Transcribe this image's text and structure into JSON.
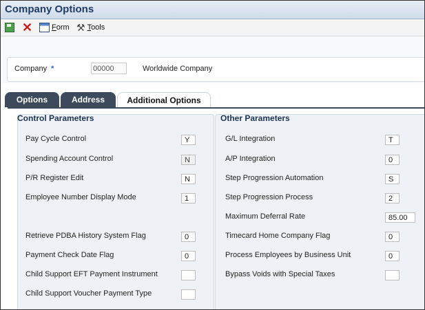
{
  "window": {
    "title": "Company Options"
  },
  "toolbar": {
    "save_icon": "save-icon",
    "cancel_icon": "cancel-icon",
    "form_label_u": "F",
    "form_label_rest": "orm",
    "tools_label_u": "T",
    "tools_label_rest": "ools"
  },
  "company": {
    "label": "Company",
    "required_mark": "*",
    "value": "00000",
    "name": "Worldwide Company"
  },
  "tabs": [
    {
      "label": "Options",
      "active": false
    },
    {
      "label": "Address",
      "active": false
    },
    {
      "label": "Additional Options",
      "active": true
    }
  ],
  "control_parameters": {
    "title": "Control Parameters",
    "fields": [
      {
        "label": "Pay Cycle Control",
        "value": "Y",
        "readonly": false
      },
      {
        "label": "Spending Account Control",
        "value": "N",
        "readonly": true
      },
      {
        "label": "P/R Register Edit",
        "value": "N",
        "readonly": false
      },
      {
        "label": "Employee Number Display Mode",
        "value": "1",
        "readonly": false
      },
      {
        "label": "Retrieve PDBA History System Flag",
        "value": "0",
        "readonly": false
      },
      {
        "label": "Payment Check Date Flag",
        "value": "0",
        "readonly": false
      },
      {
        "label": "Child Support EFT Payment Instrument",
        "value": "",
        "readonly": false
      },
      {
        "label": "Child Support Voucher Payment Type",
        "value": "",
        "readonly": false
      }
    ]
  },
  "other_parameters": {
    "title": "Other Parameters",
    "fields": [
      {
        "label": "G/L Integration",
        "value": "T"
      },
      {
        "label": "A/P Integration",
        "value": "0"
      },
      {
        "label": "Step Progression Automation",
        "value": "S"
      },
      {
        "label": "Step Progression Process",
        "value": "2"
      },
      {
        "label": "Maximum Deferral Rate",
        "value": "85.00"
      },
      {
        "label": "Timecard Home Company Flag",
        "value": "0"
      },
      {
        "label": "Process Employees by Business Unit",
        "value": "0"
      },
      {
        "label": "Bypass Voids with Special Taxes",
        "value": ""
      }
    ]
  }
}
